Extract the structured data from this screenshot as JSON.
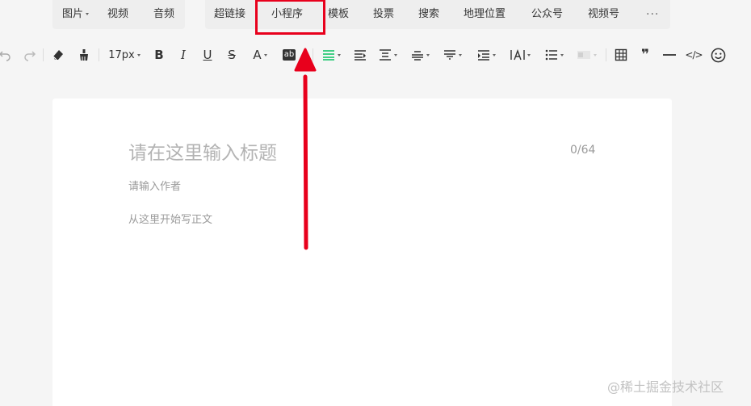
{
  "insert_bar": {
    "image": "图片",
    "video": "视频",
    "audio": "音频",
    "hyperlink": "超链接",
    "mini_program": "小程序",
    "template": "模板",
    "vote": "投票",
    "search": "搜索",
    "location": "地理位置",
    "official_account": "公众号",
    "channels": "视频号",
    "more": "···"
  },
  "toolbar": {
    "font_size": "17px",
    "bold": "B",
    "italic": "I",
    "underline": "U",
    "strike": "S",
    "font_color": "A",
    "background_color": "ab",
    "quote": "❞",
    "code": "</>"
  },
  "editor": {
    "title_placeholder": "请在这里输入标题",
    "title_count": "0/64",
    "author_placeholder": "请输入作者",
    "body_placeholder": "从这里开始写正文"
  },
  "watermark": "@稀土掘金技术社区",
  "colors": {
    "highlight": "#e8001c",
    "align_active": "#07c160"
  }
}
